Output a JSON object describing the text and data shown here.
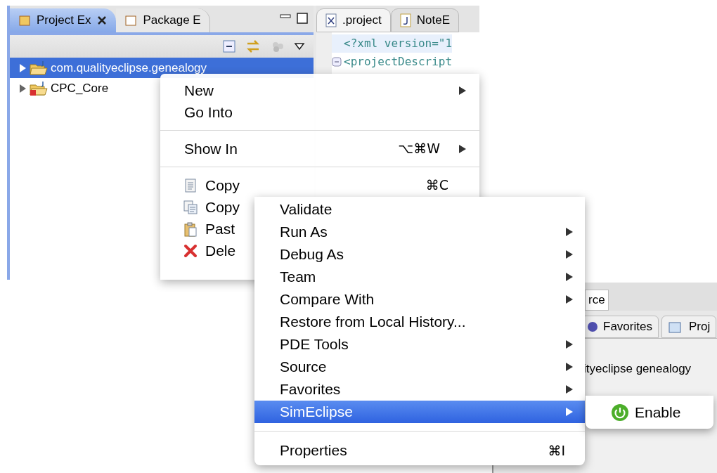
{
  "views": {
    "tabs": [
      {
        "label": "Project Ex",
        "selected": true
      },
      {
        "label": "Package E",
        "selected": false
      }
    ],
    "tree": [
      {
        "label": "com.qualityeclipse.genealogy",
        "selected": true,
        "expanded": false,
        "error": false
      },
      {
        "label": "CPC_Core",
        "selected": false,
        "expanded": false,
        "error": true
      }
    ]
  },
  "editor": {
    "tabs": [
      {
        "label": ".project",
        "kind": "xml",
        "selected": true
      },
      {
        "label": "NoteE",
        "kind": "java",
        "selected": false
      }
    ],
    "lines": [
      "<?xml version=\"1",
      "<projectDescript"
    ]
  },
  "context_menu": {
    "items": [
      {
        "kind": "item",
        "label": "New",
        "submenu": true
      },
      {
        "kind": "item",
        "label": "Go Into",
        "submenu": false
      },
      {
        "kind": "separator"
      },
      {
        "kind": "item",
        "label": "Show In",
        "shortcut": "⌥⌘W",
        "submenu": true
      },
      {
        "kind": "separator"
      },
      {
        "kind": "icon_item",
        "label": "Copy",
        "shortcut": "⌘C",
        "submenu": false
      },
      {
        "kind": "icon_item",
        "label": "Copy"
      },
      {
        "kind": "icon_item",
        "label": "Past"
      },
      {
        "kind": "icon_item",
        "label": "Dele"
      }
    ]
  },
  "background_panel": {
    "editor_tab": "rce",
    "view_tabs": [
      "Favorites",
      "Proj"
    ],
    "tree_text": "ityeclipse genealogy"
  },
  "context_menu_2": {
    "items": [
      {
        "kind": "item",
        "label": "Validate",
        "submenu": false,
        "selected": false
      },
      {
        "kind": "item",
        "label": "Run As",
        "submenu": true,
        "selected": false
      },
      {
        "kind": "item",
        "label": "Debug As",
        "submenu": true,
        "selected": false
      },
      {
        "kind": "item",
        "label": "Team",
        "submenu": true,
        "selected": false
      },
      {
        "kind": "item",
        "label": "Compare With",
        "submenu": true,
        "selected": false
      },
      {
        "kind": "item",
        "label": "Restore from Local History...",
        "submenu": false,
        "selected": false
      },
      {
        "kind": "item",
        "label": "PDE Tools",
        "submenu": true,
        "selected": false
      },
      {
        "kind": "item",
        "label": "Source",
        "submenu": true,
        "selected": false
      },
      {
        "kind": "item",
        "label": "Favorites",
        "submenu": true,
        "selected": false
      },
      {
        "kind": "item",
        "label": "SimEclipse",
        "submenu": true,
        "selected": true
      },
      {
        "kind": "separator"
      },
      {
        "kind": "item",
        "label": "Properties",
        "shortcut": "⌘I",
        "submenu": false,
        "selected": false
      }
    ]
  },
  "submenu": {
    "items": [
      {
        "label": "Enable"
      }
    ]
  }
}
